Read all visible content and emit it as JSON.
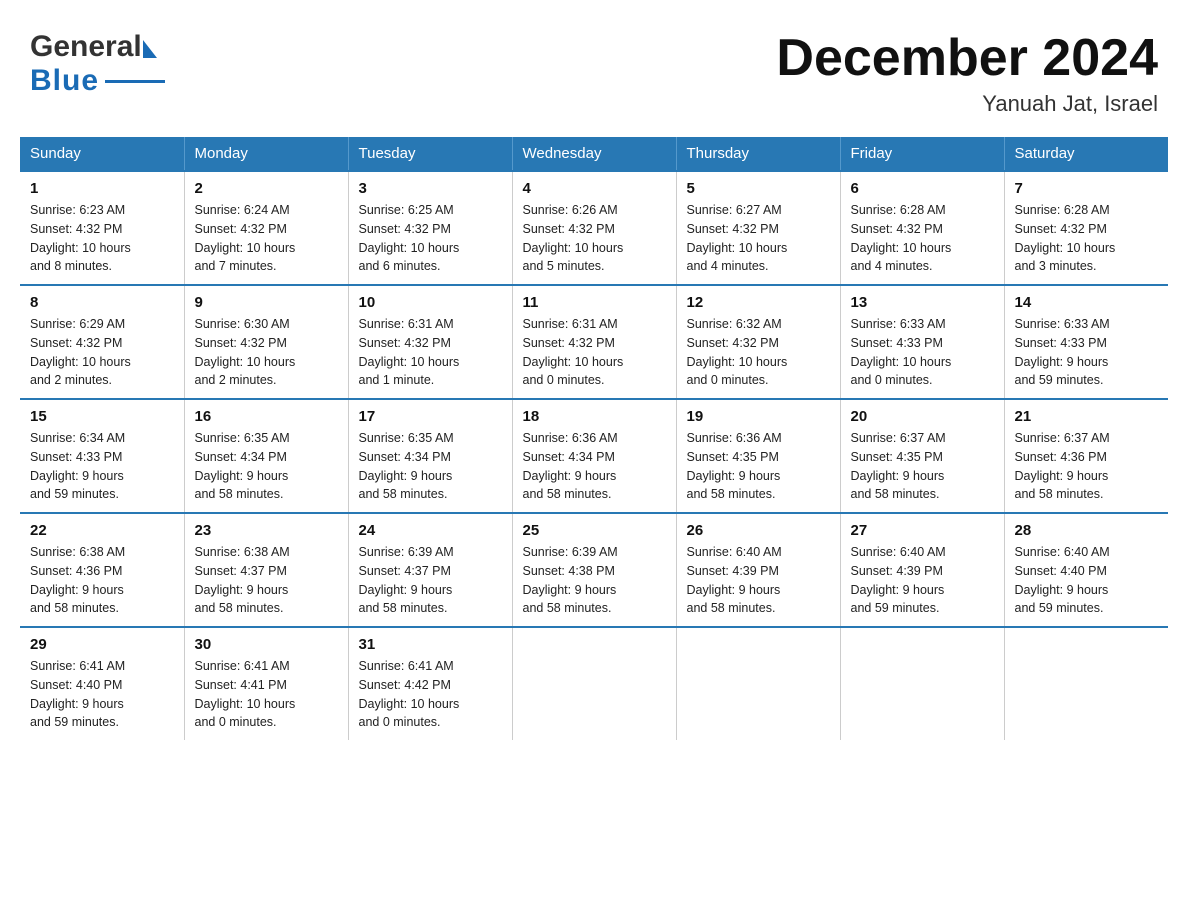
{
  "header": {
    "logo_general": "General",
    "logo_blue": "Blue",
    "month_title": "December 2024",
    "location": "Yanuah Jat, Israel"
  },
  "days_of_week": [
    "Sunday",
    "Monday",
    "Tuesday",
    "Wednesday",
    "Thursday",
    "Friday",
    "Saturday"
  ],
  "weeks": [
    [
      {
        "day": "1",
        "sunrise": "6:23 AM",
        "sunset": "4:32 PM",
        "daylight": "10 hours and 8 minutes."
      },
      {
        "day": "2",
        "sunrise": "6:24 AM",
        "sunset": "4:32 PM",
        "daylight": "10 hours and 7 minutes."
      },
      {
        "day": "3",
        "sunrise": "6:25 AM",
        "sunset": "4:32 PM",
        "daylight": "10 hours and 6 minutes."
      },
      {
        "day": "4",
        "sunrise": "6:26 AM",
        "sunset": "4:32 PM",
        "daylight": "10 hours and 5 minutes."
      },
      {
        "day": "5",
        "sunrise": "6:27 AM",
        "sunset": "4:32 PM",
        "daylight": "10 hours and 4 minutes."
      },
      {
        "day": "6",
        "sunrise": "6:28 AM",
        "sunset": "4:32 PM",
        "daylight": "10 hours and 4 minutes."
      },
      {
        "day": "7",
        "sunrise": "6:28 AM",
        "sunset": "4:32 PM",
        "daylight": "10 hours and 3 minutes."
      }
    ],
    [
      {
        "day": "8",
        "sunrise": "6:29 AM",
        "sunset": "4:32 PM",
        "daylight": "10 hours and 2 minutes."
      },
      {
        "day": "9",
        "sunrise": "6:30 AM",
        "sunset": "4:32 PM",
        "daylight": "10 hours and 2 minutes."
      },
      {
        "day": "10",
        "sunrise": "6:31 AM",
        "sunset": "4:32 PM",
        "daylight": "10 hours and 1 minute."
      },
      {
        "day": "11",
        "sunrise": "6:31 AM",
        "sunset": "4:32 PM",
        "daylight": "10 hours and 0 minutes."
      },
      {
        "day": "12",
        "sunrise": "6:32 AM",
        "sunset": "4:32 PM",
        "daylight": "10 hours and 0 minutes."
      },
      {
        "day": "13",
        "sunrise": "6:33 AM",
        "sunset": "4:33 PM",
        "daylight": "10 hours and 0 minutes."
      },
      {
        "day": "14",
        "sunrise": "6:33 AM",
        "sunset": "4:33 PM",
        "daylight": "9 hours and 59 minutes."
      }
    ],
    [
      {
        "day": "15",
        "sunrise": "6:34 AM",
        "sunset": "4:33 PM",
        "daylight": "9 hours and 59 minutes."
      },
      {
        "day": "16",
        "sunrise": "6:35 AM",
        "sunset": "4:34 PM",
        "daylight": "9 hours and 58 minutes."
      },
      {
        "day": "17",
        "sunrise": "6:35 AM",
        "sunset": "4:34 PM",
        "daylight": "9 hours and 58 minutes."
      },
      {
        "day": "18",
        "sunrise": "6:36 AM",
        "sunset": "4:34 PM",
        "daylight": "9 hours and 58 minutes."
      },
      {
        "day": "19",
        "sunrise": "6:36 AM",
        "sunset": "4:35 PM",
        "daylight": "9 hours and 58 minutes."
      },
      {
        "day": "20",
        "sunrise": "6:37 AM",
        "sunset": "4:35 PM",
        "daylight": "9 hours and 58 minutes."
      },
      {
        "day": "21",
        "sunrise": "6:37 AM",
        "sunset": "4:36 PM",
        "daylight": "9 hours and 58 minutes."
      }
    ],
    [
      {
        "day": "22",
        "sunrise": "6:38 AM",
        "sunset": "4:36 PM",
        "daylight": "9 hours and 58 minutes."
      },
      {
        "day": "23",
        "sunrise": "6:38 AM",
        "sunset": "4:37 PM",
        "daylight": "9 hours and 58 minutes."
      },
      {
        "day": "24",
        "sunrise": "6:39 AM",
        "sunset": "4:37 PM",
        "daylight": "9 hours and 58 minutes."
      },
      {
        "day": "25",
        "sunrise": "6:39 AM",
        "sunset": "4:38 PM",
        "daylight": "9 hours and 58 minutes."
      },
      {
        "day": "26",
        "sunrise": "6:40 AM",
        "sunset": "4:39 PM",
        "daylight": "9 hours and 58 minutes."
      },
      {
        "day": "27",
        "sunrise": "6:40 AM",
        "sunset": "4:39 PM",
        "daylight": "9 hours and 59 minutes."
      },
      {
        "day": "28",
        "sunrise": "6:40 AM",
        "sunset": "4:40 PM",
        "daylight": "9 hours and 59 minutes."
      }
    ],
    [
      {
        "day": "29",
        "sunrise": "6:41 AM",
        "sunset": "4:40 PM",
        "daylight": "9 hours and 59 minutes."
      },
      {
        "day": "30",
        "sunrise": "6:41 AM",
        "sunset": "4:41 PM",
        "daylight": "10 hours and 0 minutes."
      },
      {
        "day": "31",
        "sunrise": "6:41 AM",
        "sunset": "4:42 PM",
        "daylight": "10 hours and 0 minutes."
      },
      {
        "day": "",
        "sunrise": "",
        "sunset": "",
        "daylight": ""
      },
      {
        "day": "",
        "sunrise": "",
        "sunset": "",
        "daylight": ""
      },
      {
        "day": "",
        "sunrise": "",
        "sunset": "",
        "daylight": ""
      },
      {
        "day": "",
        "sunrise": "",
        "sunset": "",
        "daylight": ""
      }
    ]
  ],
  "labels": {
    "sunrise": "Sunrise:",
    "sunset": "Sunset:",
    "daylight": "Daylight:"
  }
}
